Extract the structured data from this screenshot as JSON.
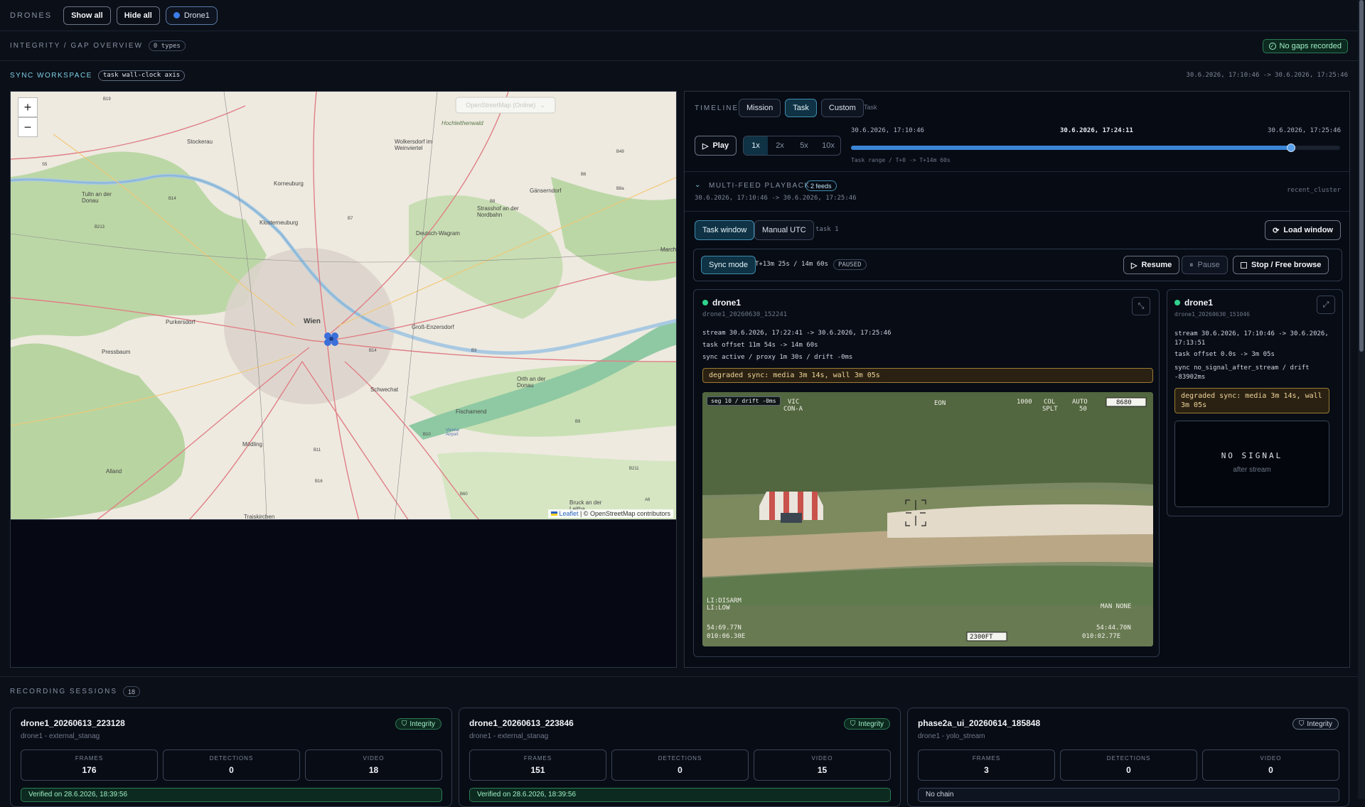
{
  "topbar": {
    "drones_label": "DRONES",
    "show_all": "Show all",
    "hide_all": "Hide all",
    "drone_chip": "Drone1"
  },
  "integrity": {
    "title": "INTEGRITY / GAP OVERVIEW",
    "types": "0 types",
    "status": "No gaps recorded"
  },
  "workspace": {
    "title": "SYNC WORKSPACE",
    "axis_chip": "task wall-clock axis",
    "range": "30.6.2026, 17:10:46 -> 30.6.2026, 17:25:46"
  },
  "map": {
    "layer": "OpenStreetMap (Online)",
    "zoom_in": "+",
    "zoom_out": "−",
    "attribution_leaflet": "Leaflet",
    "attribution_rest": " | © OpenStreetMap contributors",
    "places": [
      "Stockerau",
      "Wolkersdorf im Weinviertel",
      "Korneuburg",
      "Gänserndorf",
      "Tulln an der Donau",
      "Strasshof an der Nordbahn",
      "Klosterneuburg",
      "Deutsch-Wagram",
      "Purkersdorf",
      "Wien",
      "Groß-Enzersdorf",
      "Pressbaum",
      "Orth an der Donau",
      "Schwechat",
      "Fischamend",
      "Mödling",
      "Alland",
      "Traiskirchen",
      "Bruck an der Leitha",
      "Vienna Airport",
      "Marchegg",
      "Hochleithenwald"
    ],
    "roads": [
      "B19",
      "S5",
      "B14",
      "B213",
      "B7",
      "B8",
      "B49",
      "B6",
      "B8a",
      "B3",
      "B14",
      "B10",
      "B11",
      "B16",
      "B60",
      "B9",
      "B211",
      "A6"
    ]
  },
  "timeline": {
    "label": "TIMELINE",
    "tabs": [
      "Mission",
      "Task",
      "Custom"
    ],
    "active_tab": "Task",
    "hint": "Task",
    "play": "Play",
    "speeds": [
      "1x",
      "2x",
      "5x",
      "10x"
    ],
    "active_speed": "1x",
    "start": "30.6.2026, 17:10:46",
    "current": "30.6.2026, 17:24:11",
    "end": "30.6.2026, 17:25:46",
    "progress": 0.9,
    "range_note": "Task range / T+0 -> T+14m 60s"
  },
  "playback": {
    "title": "MULTI-FEED PLAYBACK",
    "feeds_chip": "2 feeds",
    "range": "30.6.2026, 17:10:46 -> 30.6.2026, 17:25:46",
    "cluster": "recent_cluster",
    "task_window": "Task window",
    "manual_utc": "Manual UTC",
    "task_label": "task 1",
    "load_window": "Load window",
    "sync_mode": "Sync mode",
    "sync_status": "T+13m 25s / 14m 60s",
    "paused_chip": "PAUSED",
    "resume": "Resume",
    "pause": "Pause",
    "stop": "Stop / Free browse"
  },
  "feed1": {
    "name": "drone1",
    "id": "drone1_20260630_152241",
    "stream": "stream 30.6.2026, 17:22:41 -> 30.6.2026, 17:25:46",
    "offset": "task offset 11m 54s -> 14m 60s",
    "sync": "sync active / proxy 1m 30s / drift -0ms",
    "warning": "degraded sync: media 3m 14s, wall 3m 05s",
    "video_tag": "seg 10 / drift -0ms",
    "hud": [
      "STO",
      "VIC",
      "CON-A",
      "EON",
      "1000",
      "COL",
      "SPLT",
      "AUTO",
      "50",
      "8680",
      "LI:DISARM",
      "LI:LOW",
      "MAN",
      "NONE",
      "2300FT",
      "54:69.77N",
      "010:06.30E",
      "54:44.70N",
      "010:02.77E"
    ]
  },
  "feed2": {
    "name": "drone1",
    "id": "drone1_20260630_151046",
    "stream": "stream 30.6.2026, 17:10:46 -> 30.6.2026, 17:13:51",
    "offset": "task offset 0.0s -> 3m 05s",
    "sync": "sync no_signal_after_stream / drift -83902ms",
    "warning": "degraded sync: media 3m 14s, wall 3m 05s",
    "no_signal": "NO SIGNAL",
    "after_stream": "after stream"
  },
  "sessions": {
    "title": "RECORDING SESSIONS",
    "count": "18",
    "items": [
      {
        "name": "drone1_20260613_223128",
        "source": "drone1 - external_stanag",
        "badge": "Integrity",
        "frames": "176",
        "detections": "0",
        "video": "18",
        "footer": "Verified on 28.6.2026, 18:39:56"
      },
      {
        "name": "drone1_20260613_223846",
        "source": "drone1 - external_stanag",
        "badge": "Integrity",
        "frames": "151",
        "detections": "0",
        "video": "15",
        "footer": "Verified on 28.6.2026, 18:39:56"
      },
      {
        "name": "phase2a_ui_20260614_185848",
        "source": "drone1 - yolo_stream",
        "badge": "Integrity",
        "frames": "3",
        "detections": "0",
        "video": "0",
        "footer": "No chain"
      }
    ],
    "labels": {
      "frames": "FRAMES",
      "detections": "DETECTIONS",
      "video": "VIDEO"
    }
  },
  "colors": {
    "accent": "#3f8db0",
    "ok": "#2fd48a",
    "warn": "#9c7b34"
  }
}
